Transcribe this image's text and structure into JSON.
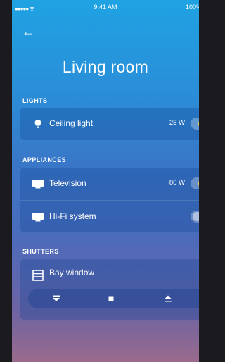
{
  "status_bar": {
    "signal": "●●●●● ",
    "wifi_icon": "wifi-icon",
    "time": "9:41 AM",
    "battery": "100%"
  },
  "header": {
    "back_icon": "arrow-left-icon",
    "title": "Living room"
  },
  "sections": {
    "lights": "LIGHTS",
    "appliances": "APPLIANCES",
    "shutters": "SHUTTERS"
  },
  "lights": {
    "ceiling": {
      "label": "Ceiling light",
      "icon": "bulb-icon",
      "power": "25 W",
      "on": true
    }
  },
  "appliances": {
    "television": {
      "label": "Television",
      "icon": "tv-icon",
      "power": "80 W",
      "on": true
    },
    "hifi": {
      "label": "Hi-Fi system",
      "icon": "tv-icon",
      "power": "",
      "on": false
    }
  },
  "shutters": {
    "bay_window": {
      "label": "Bay window",
      "icon": "shutter-icon"
    },
    "controls": [
      "close-shutter-icon",
      "stop-icon",
      "open-shutter-icon"
    ]
  },
  "colors": {
    "toggle_on": "#f7d24b",
    "accent": "#1fa3e3"
  }
}
